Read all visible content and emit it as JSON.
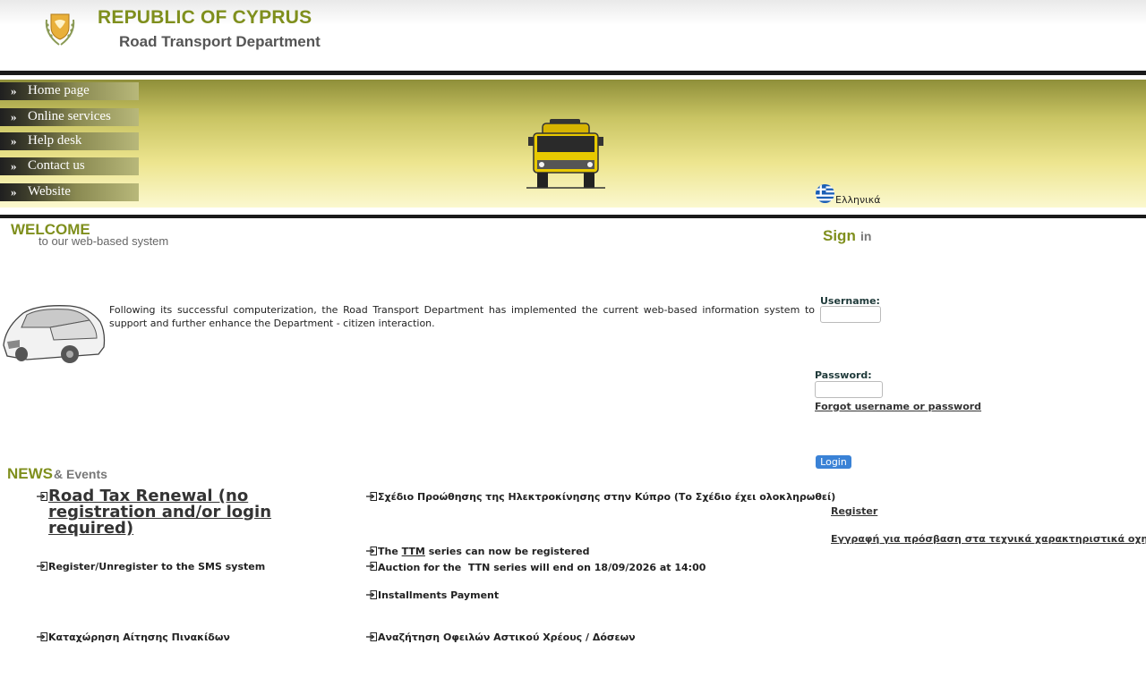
{
  "header": {
    "title": "REPUBLIC OF CYPRUS",
    "subtitle": "Road Transport Department"
  },
  "nav": {
    "items": [
      {
        "label": "Home page"
      },
      {
        "label": "Online services"
      },
      {
        "label": "Help desk"
      },
      {
        "label": "Contact us"
      },
      {
        "label": "Website"
      }
    ],
    "chevron": "»"
  },
  "language": {
    "label": "Ελληνικά",
    "icon": "greek-flag-icon"
  },
  "welcome": {
    "title": "WELCOME",
    "subtitle": "to our web-based system",
    "intro": "Following its successful computerization, the Road Transport Department has implemented the current web-based information system to support and further enhance the Department - citizen interaction."
  },
  "signin": {
    "title_1": "Sign",
    "title_2": "in",
    "username_label": "Username:",
    "password_label": "Password:",
    "forgot": "Forgot username or password",
    "login": "Login",
    "register": "Register",
    "register_technical": "Εγγραφή για πρόσβαση στα τεχνικά χαρακτηριστικά οχημάτων"
  },
  "news": {
    "title": "NEWS",
    "title_2": "& Events",
    "road_tax": "Road Tax Renewal (no registration and/or login required)",
    "sms": "Register/Unregister to the SMS system",
    "plates": "Καταχώρηση Αίτησης Πινακίδων",
    "ev_scheme": "Σχέδιο Προώθησης της Ηλεκτροκίνησης στην Κύπρο (Το Σχέδιο έχει ολοκληρωθεί)",
    "ttm_prefix": "The",
    "ttm_code": "TTM",
    "ttm_suffix": "series can now be registered",
    "auction": "Auction for the  TTN series will end on 18/09/2026 at 14:00",
    "installments": "Installments Payment",
    "debts": "Αναζήτηση Οφειλών Αστικού Χρέους / Δόσεων"
  },
  "colors": {
    "accent": "#7f8f1d",
    "login_button": "#3a82d6",
    "dark_bar": "#1a1a1a"
  }
}
